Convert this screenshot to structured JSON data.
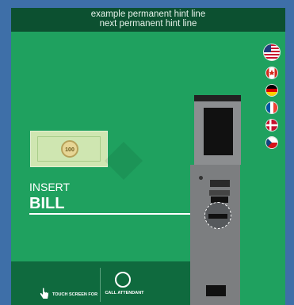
{
  "hint": {
    "line1": "example permanent hint line",
    "line2": "next permanent hint line"
  },
  "languages": [
    {
      "code": "us",
      "icon": "us-flag-icon"
    },
    {
      "code": "ca",
      "icon": "canada-flag-icon"
    },
    {
      "code": "de",
      "icon": "germany-flag-icon"
    },
    {
      "code": "fr",
      "icon": "france-flag-icon"
    },
    {
      "code": "dk",
      "icon": "denmark-flag-icon"
    },
    {
      "code": "cz",
      "icon": "czech-flag-icon"
    }
  ],
  "bill": {
    "denomination": "100"
  },
  "instruction": {
    "action": "INSERT",
    "item": "BILL"
  },
  "footer": {
    "touch_label": "TOUCH SCREEN FOR",
    "call_label": "CALL ATTENDANT"
  },
  "colors": {
    "screen_bg": "#1fa15f",
    "hint_bg": "#0c5030",
    "frame": "#3e6fa8"
  }
}
